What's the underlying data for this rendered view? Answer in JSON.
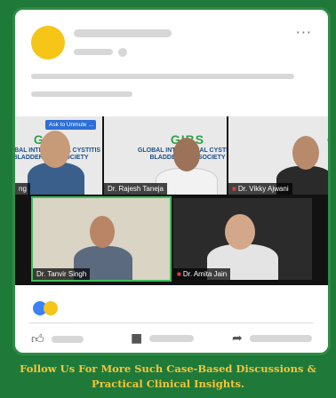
{
  "post": {
    "more_label": "···"
  },
  "meeting": {
    "unmute_label": "Ask to Unmute",
    "unmute_extra": "...",
    "logo_text": "GIBS",
    "logo_line1": "GLOBAL INTERSTITIAL CYSTITIS",
    "logo_line2": "BLADDER PAIN SOCIETY",
    "participants": [
      {
        "name": "ng"
      },
      {
        "name": "Dr. Rajesh Taneja"
      },
      {
        "name": "Dr. Vikky Ajwani",
        "muted": true
      },
      {
        "name": "Dr. Tanvir Singh",
        "speaking": true
      },
      {
        "name": "Dr. Amita Jain",
        "muted": true
      }
    ]
  },
  "actions": {
    "like_icon": "thumbs-up-icon",
    "comment_icon": "comment-icon",
    "share_icon": "share-arrow-icon"
  },
  "colors": {
    "background": "#1f7a3a",
    "footer_text": "#f4c43b",
    "avatar": "#f5c518",
    "reaction_blue": "#3b82f6",
    "reaction_yellow": "#f5c518"
  },
  "footer": {
    "line1": "Follow Us For More Such Case-Based Discussions &",
    "line2": "Practical Clinical Insights."
  }
}
